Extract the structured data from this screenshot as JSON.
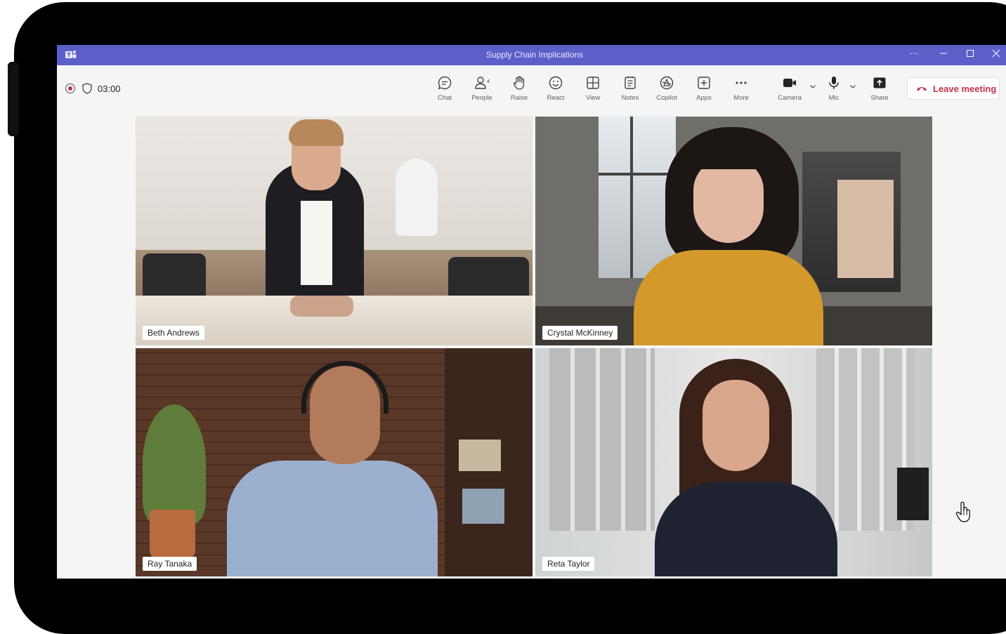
{
  "window": {
    "title": "Supply Chain Implications",
    "more_label": "···"
  },
  "status": {
    "timer": "03:00"
  },
  "toolbar": {
    "items": [
      {
        "label": "Chat",
        "icon": "chat-icon"
      },
      {
        "label": "People",
        "icon": "people-icon",
        "badge": "4"
      },
      {
        "label": "Raise",
        "icon": "raise-hand-icon"
      },
      {
        "label": "React",
        "icon": "react-icon"
      },
      {
        "label": "View",
        "icon": "view-icon"
      },
      {
        "label": "Notes",
        "icon": "notes-icon"
      },
      {
        "label": "Copilot",
        "icon": "copilot-icon"
      },
      {
        "label": "Apps",
        "icon": "apps-icon"
      },
      {
        "label": "More",
        "icon": "more-icon"
      },
      {
        "label": "Camera",
        "icon": "camera-icon"
      },
      {
        "label": "Mic",
        "icon": "mic-icon"
      },
      {
        "label": "Share",
        "icon": "share-icon"
      }
    ],
    "more_glyph": "···",
    "leave_label": "Leave meeting"
  },
  "participants": [
    {
      "name": "Beth Andrews"
    },
    {
      "name": "Crystal McKinney"
    },
    {
      "name": "Ray Tanaka"
    },
    {
      "name": "Reta Taylor"
    }
  ],
  "colors": {
    "accent": "#5b5fc7",
    "leave": "#c4314b"
  }
}
